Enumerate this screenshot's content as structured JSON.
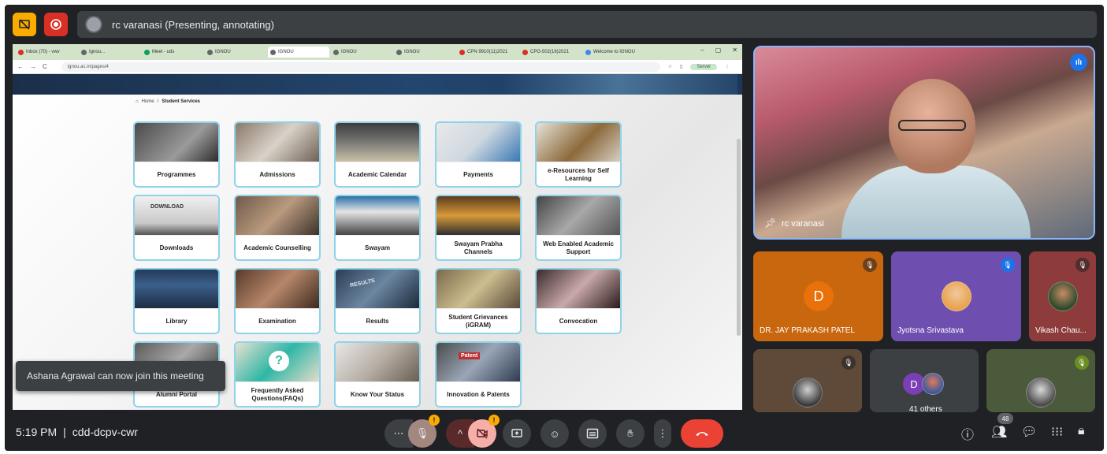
{
  "presenter_bar": {
    "text": "rc varanasi (Presenting, annotating)"
  },
  "shared_screen": {
    "tabs": [
      "Inbox (70) - vwv",
      "Ignou...",
      "Meet - uds",
      "IGNOU",
      "IGNOU",
      "IGNOU",
      "IGNOU",
      "CPN 9910(11)2021",
      "CPG-502(16)2021",
      "Welcome to IGNOU"
    ],
    "url": "ignou.ac.in/pages/4",
    "profile": "Server",
    "breadcrumb_home": "Home",
    "breadcrumb_sep": "/",
    "breadcrumb_current": "Student Services",
    "cards": [
      "Programmes",
      "Admissions",
      "Academic Calendar",
      "Payments",
      "e-Resources for Self Learning",
      "Downloads",
      "Academic Counselling",
      "Swayam",
      "Swayam Prabha Channels",
      "Web Enabled Academic Support",
      "Library",
      "Examination",
      "Results",
      "Student Grievances (iGRAM)",
      "Convocation",
      "Alumni Portal",
      "Frequently Asked Questions(FAQs)",
      "Know Your Status",
      "Innovation & Patents"
    ],
    "thumb_texts": {
      "download": "DOWNLOAD",
      "faq": "?",
      "results": "RESULTS",
      "patent": "Patent"
    }
  },
  "toast": {
    "text": "Ashana Agrawal can now join this meeting"
  },
  "main_tile": {
    "name": "rc varanasi"
  },
  "participants": [
    {
      "name": "DR. JAY PRAKASH PATEL",
      "initial": "D",
      "bg": "#c9670f",
      "avatar_color": "#e8710a"
    },
    {
      "name": "Jyotsna Srivastava",
      "bg": "#6e4fb0"
    },
    {
      "name": "Vikash Chau...",
      "bg": "#8e3b3b"
    }
  ],
  "others": {
    "initial": "D",
    "label": "41 others",
    "avatar_color": "#7b3fb5"
  },
  "bottom_bar": {
    "time": "5:19 PM",
    "separator": "|",
    "meeting_code": "cdd-dcpv-cwr",
    "people_count": "48",
    "warn_mark": "!"
  },
  "colors": {
    "accent": "#8ab4f8",
    "end_call": "#ea4335",
    "mic_active": "#a3887f"
  }
}
